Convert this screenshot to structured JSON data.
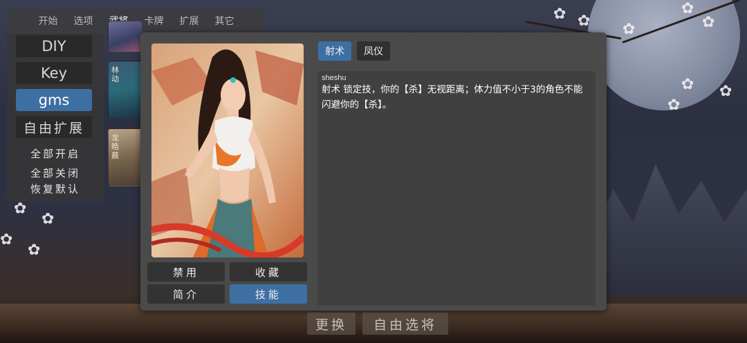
{
  "topbar": {
    "tabs": [
      {
        "label": "开始",
        "active": false
      },
      {
        "label": "选项",
        "active": false
      },
      {
        "label": "武将",
        "active": true
      },
      {
        "label": "卡牌",
        "active": false
      },
      {
        "label": "扩展",
        "active": false
      },
      {
        "label": "其它",
        "active": false
      }
    ]
  },
  "sidebar": {
    "items": [
      {
        "label": "DIY",
        "active": false
      },
      {
        "label": "Key",
        "active": false
      },
      {
        "label": "gms",
        "active": true
      },
      {
        "label": "自由扩展",
        "active": false
      }
    ],
    "links": [
      "全部开启",
      "全部关闭",
      "恢复默认"
    ]
  },
  "thumbnails": [
    {
      "name": ""
    },
    {
      "name": "林动"
    },
    {
      "name": "龙皓晨"
    }
  ],
  "dialog": {
    "actions": {
      "disable": "禁用",
      "favorite": "收藏",
      "intro": "简介",
      "skills": "技能"
    },
    "skill_tabs": [
      {
        "label": "射术",
        "active": true
      },
      {
        "label": "凤仪",
        "active": false
      }
    ],
    "skill": {
      "id": "sheshu",
      "text": "射术 锁定技，你的【杀】无视距离；体力值不小于3的角色不能闪避你的【杀】。"
    }
  },
  "bottom": {
    "change": "更换",
    "free_select": "自由选将"
  },
  "colors": {
    "accent": "#3e6fa3",
    "panel": "#4a4a4a",
    "button": "#333333"
  }
}
